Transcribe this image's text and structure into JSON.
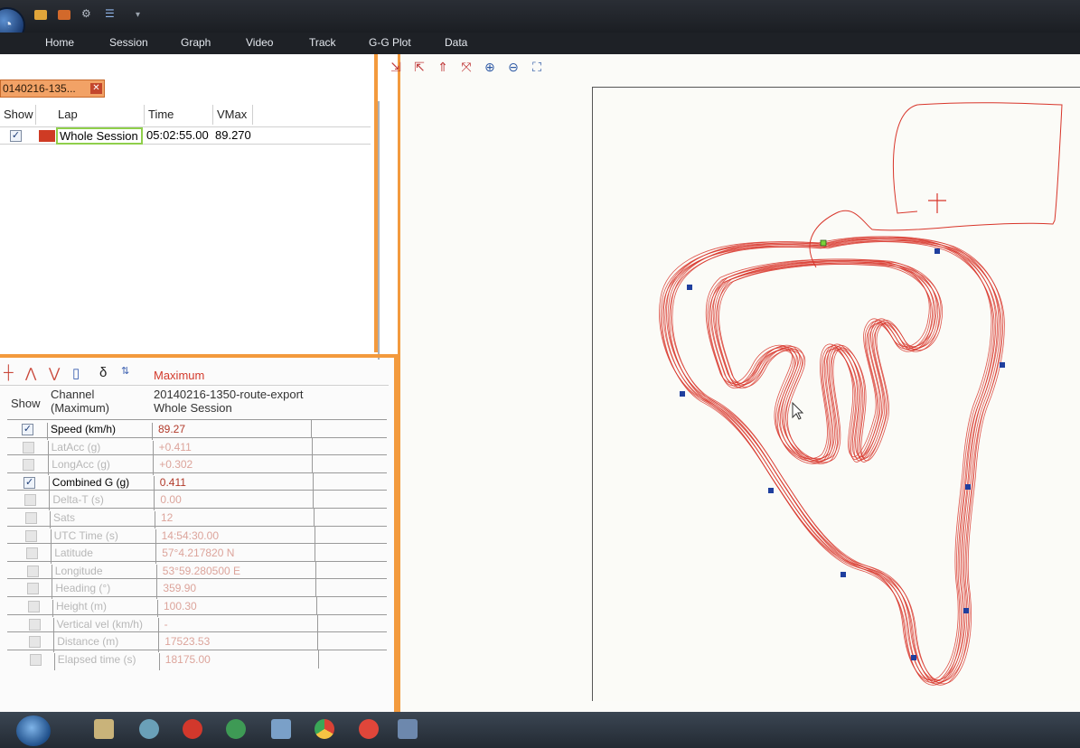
{
  "ribbon": {
    "tabs": [
      "Home",
      "Session",
      "Graph",
      "Video",
      "Track",
      "G-G Plot",
      "Data"
    ]
  },
  "session_tab": {
    "label": "0140216-135...",
    "close_glyph": "✕"
  },
  "laps": {
    "columns": [
      "Show",
      "Lap",
      "Time",
      "VMax"
    ],
    "rows": [
      {
        "show": true,
        "color": "#cf3b24",
        "lap": "Whole Session",
        "time": "05:02:55.00",
        "vmax": "89.270"
      }
    ]
  },
  "channels": {
    "toolbar_label": "Maximum",
    "toolbar_icons": [
      "cursor-icon",
      "max-icon",
      "min-icon",
      "range-icon",
      "delta-icon",
      "delta-value-icon"
    ],
    "col_show": "Show",
    "col_channel": "Channel\n(Maximum)",
    "col_session": "20140216-1350-route-export\nWhole Session",
    "rows": [
      {
        "checked": true,
        "enabled": true,
        "name": "Speed (km/h)",
        "value": "89.27"
      },
      {
        "checked": false,
        "enabled": false,
        "name": "LatAcc (g)",
        "value": "+0.411"
      },
      {
        "checked": false,
        "enabled": false,
        "name": "LongAcc (g)",
        "value": "+0.302"
      },
      {
        "checked": true,
        "enabled": true,
        "name": "Combined G (g)",
        "value": "0.411"
      },
      {
        "checked": false,
        "enabled": false,
        "name": "Delta-T (s)",
        "value": "0.00"
      },
      {
        "checked": false,
        "enabled": false,
        "name": "Sats",
        "value": "12"
      },
      {
        "checked": false,
        "enabled": false,
        "name": "UTC Time (s)",
        "value": "14:54:30.00"
      },
      {
        "checked": false,
        "enabled": false,
        "name": "Latitude",
        "value": "57°4.217820 N"
      },
      {
        "checked": false,
        "enabled": false,
        "name": "Longitude",
        "value": "53°59.280500 E"
      },
      {
        "checked": false,
        "enabled": false,
        "name": "Heading (°)",
        "value": "359.90"
      },
      {
        "checked": false,
        "enabled": false,
        "name": "Height (m)",
        "value": "100.30"
      },
      {
        "checked": false,
        "enabled": false,
        "name": "Vertical vel (km/h)",
        "value": "-"
      },
      {
        "checked": false,
        "enabled": false,
        "name": "Distance (m)",
        "value": "17523.53"
      },
      {
        "checked": false,
        "enabled": false,
        "name": "Elapsed time (s)",
        "value": "18175.00"
      }
    ]
  },
  "track": {
    "toolbar_icons": [
      "split-left-icon",
      "split-right-icon",
      "split-up-icon",
      "split-remove-icon",
      "zoom-in-icon",
      "zoom-out-icon",
      "zoom-fit-icon"
    ],
    "line_color": "#d8352a",
    "marker_color": "#1f3f9e",
    "start_marker_color": "#7ad13a"
  },
  "taskbar": {
    "apps": [
      "explorer-icon",
      "network-icon",
      "opera-icon",
      "browser-icon",
      "race-icon",
      "chrome-icon",
      "opera-red-icon",
      "race-logger-icon"
    ]
  }
}
